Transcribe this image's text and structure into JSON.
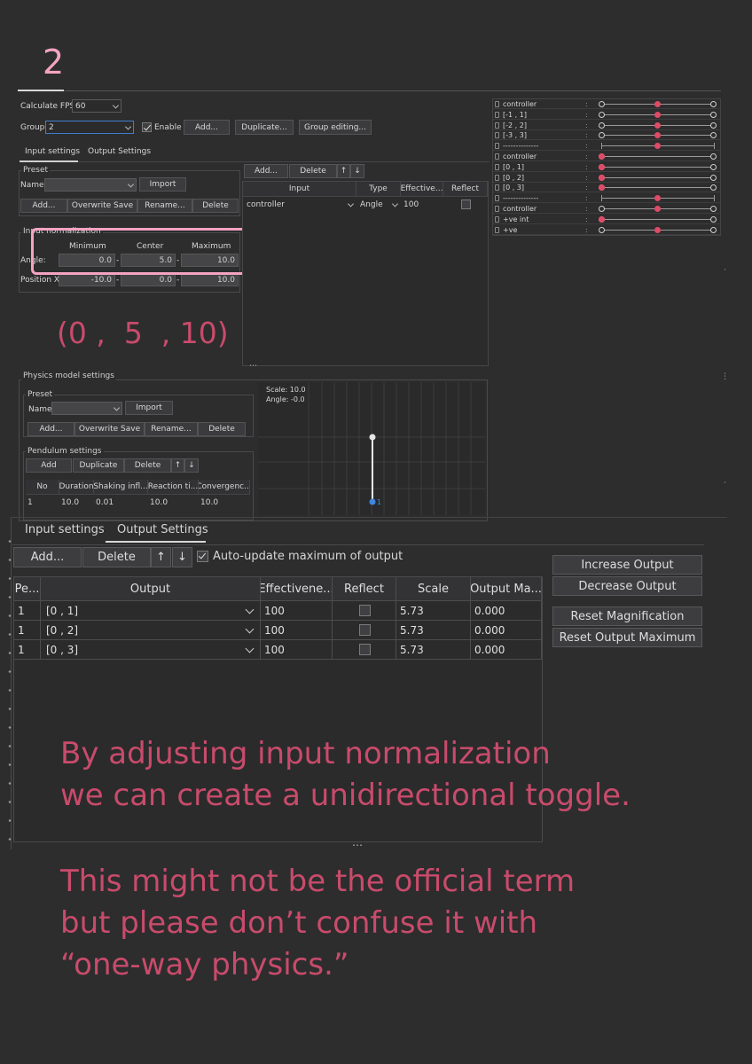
{
  "page_number": "2",
  "colors": {
    "accent_pink": "#f4a3c0",
    "annotation_text": "#c94b6b",
    "dot_red": "#e04a66",
    "dot_blue": "#3f86e0"
  },
  "top": {
    "fps_label": "Calculate FPS:",
    "fps_value": "60",
    "group_label": "Group:",
    "group_value": "2",
    "enable_label": "Enable",
    "add_label": "Add...",
    "duplicate_label": "Duplicate...",
    "group_editing_label": "Group editing...",
    "tabs": [
      "Input settings",
      "Output Settings"
    ]
  },
  "preset": {
    "title": "Preset",
    "name_label": "Name:",
    "import_label": "Import",
    "buttons": [
      "Add...",
      "Overwrite Save",
      "Rename...",
      "Delete"
    ]
  },
  "normalization": {
    "title": "Input normalization",
    "headers": [
      "Minimum",
      "Center",
      "Maximum"
    ],
    "rows": [
      {
        "label": "Angle:",
        "values": [
          "0.0",
          "5.0",
          "10.0"
        ]
      },
      {
        "label": "Position X:",
        "values": [
          "-10.0",
          "0.0",
          "10.0"
        ]
      }
    ],
    "annotation": "(0 ,  5  , 10)"
  },
  "input_table": {
    "add_label": "Add...",
    "delete_label": "Delete",
    "up_label": "↑",
    "down_label": "↓",
    "headers": [
      "Input",
      "Type",
      "Effective...",
      "Reflect"
    ],
    "rows": [
      {
        "input": "controller",
        "type": "Angle",
        "effectiveness": "100"
      }
    ]
  },
  "physics": {
    "title": "Physics model settings",
    "preset_title": "Preset",
    "name_label": "Name:",
    "import_label": "Import",
    "buttons": [
      "Add...",
      "Overwrite Save",
      "Rename...",
      "Delete"
    ],
    "pendulum_title": "Pendulum settings",
    "pendulum_buttons": [
      "Add",
      "Duplicate",
      "Delete",
      "↑",
      "↓"
    ],
    "headers": [
      "No",
      "Duration",
      "Shaking infl...",
      "Reaction ti...",
      "Convergenc..."
    ],
    "rows": [
      [
        "1",
        "10.0",
        "0.01",
        "10.0",
        "10.0"
      ]
    ],
    "scale_text": "Scale: 10.0",
    "angle_text": "Angle: -0.0",
    "pendulum_index": "1"
  },
  "params": [
    {
      "name": "controller",
      "value": 0.5,
      "type": "dots"
    },
    {
      "name": "[-1 , 1]",
      "value": 0.5,
      "type": "dots"
    },
    {
      "name": "[-2 , 2]",
      "value": 0.5,
      "type": "dots"
    },
    {
      "name": "[-3 , 3]",
      "value": 0.5,
      "type": "dots"
    },
    {
      "name": "--------------",
      "value": 0.5,
      "type": "ticks"
    },
    {
      "name": "controller",
      "value": 0.0,
      "type": "dots"
    },
    {
      "name": "[0 , 1]",
      "value": 0.0,
      "type": "dots"
    },
    {
      "name": "[0 , 2]",
      "value": 0.0,
      "type": "dots"
    },
    {
      "name": "[0 , 3]",
      "value": 0.0,
      "type": "dots"
    },
    {
      "name": "--------------",
      "value": 0.5,
      "type": "ticks"
    },
    {
      "name": "controller",
      "value": 0.5,
      "type": "dots"
    },
    {
      "name": "+ve int",
      "value": 0.0,
      "type": "dots"
    },
    {
      "name": "+ve",
      "value": 0.5,
      "type": "dots"
    }
  ],
  "output_panel": {
    "tabs": [
      "Input settings",
      "Output Settings"
    ],
    "add_label": "Add...",
    "delete_label": "Delete",
    "up_label": "↑",
    "down_label": "↓",
    "auto_update_label": "Auto-update maximum of output",
    "headers": [
      "Pe...",
      "Output",
      "Effectivene...",
      "Reflect",
      "Scale",
      "Output Ma..."
    ],
    "rows": [
      {
        "pe": "1",
        "output": "[0 , 1]",
        "eff": "100",
        "scale": "5.73",
        "max": "0.000"
      },
      {
        "pe": "1",
        "output": "[0 , 2]",
        "eff": "100",
        "scale": "5.73",
        "max": "0.000"
      },
      {
        "pe": "1",
        "output": "[0 , 3]",
        "eff": "100",
        "scale": "5.73",
        "max": "0.000"
      }
    ],
    "side_buttons": [
      "Increase Output",
      "Decrease Output",
      "Reset Magnification",
      "Reset Output Maximum"
    ]
  },
  "caption": {
    "line1": "By adjusting input normalization",
    "line2": "we can create a unidirectional toggle.",
    "line3": "This might not be the official term",
    "line4": "but please don’t confuse it with",
    "line5": "“one-way physics.”"
  }
}
